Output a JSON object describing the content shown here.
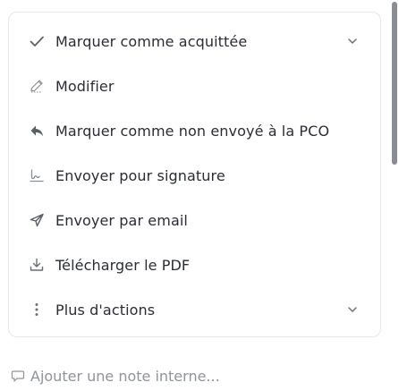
{
  "actions_card": {
    "items": [
      {
        "label": "Marquer comme acquittée",
        "icon": "check-icon",
        "has_chevron": true
      },
      {
        "label": "Modifier",
        "icon": "pencil-icon",
        "has_chevron": false
      },
      {
        "label": "Marquer comme non envoyé à la PCO",
        "icon": "reply-arrow-icon",
        "has_chevron": false
      },
      {
        "label": "Envoyer pour signature",
        "icon": "signature-icon",
        "has_chevron": false
      },
      {
        "label": "Envoyer par email",
        "icon": "send-icon",
        "has_chevron": false
      },
      {
        "label": "Télécharger le PDF",
        "icon": "download-icon",
        "has_chevron": false
      },
      {
        "label": "Plus d'actions",
        "icon": "more-vertical-icon",
        "has_chevron": true
      }
    ]
  },
  "note": {
    "placeholder": "Ajouter une note interne...",
    "icon": "comment-icon"
  },
  "colors": {
    "text": "#2a2d36",
    "icon": "#6b6f78",
    "muted": "#8f939b",
    "border": "#e6e7ea",
    "scrollbar": "#8a8d93"
  }
}
